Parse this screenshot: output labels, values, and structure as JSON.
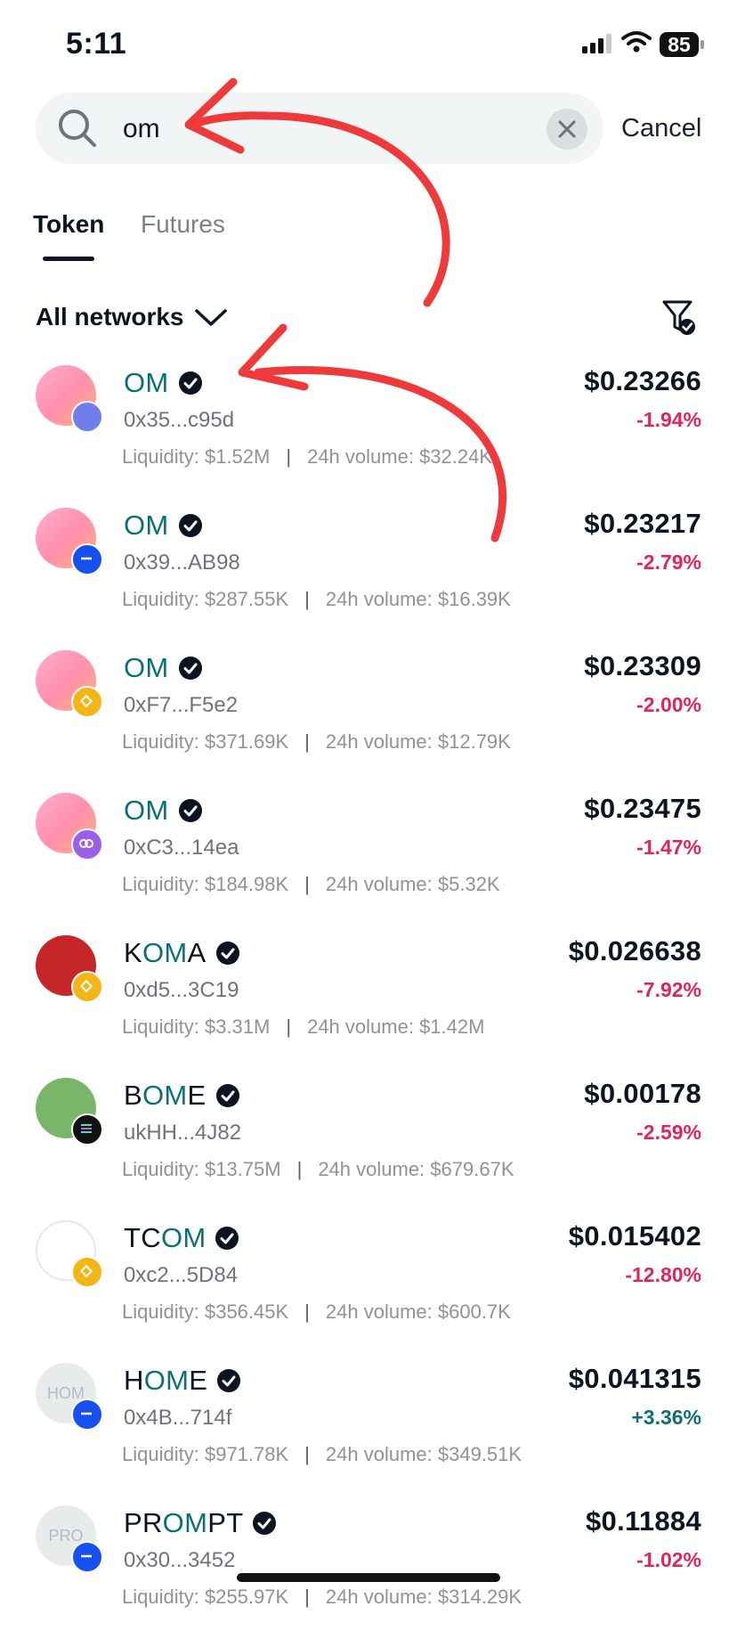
{
  "status_bar": {
    "time": "5:11",
    "battery": "85"
  },
  "search": {
    "value": "om",
    "cancel_label": "Cancel"
  },
  "tabs": [
    {
      "label": "Token",
      "active": true
    },
    {
      "label": "Futures",
      "active": false
    }
  ],
  "network_filter": {
    "label": "All networks"
  },
  "labels": {
    "liquidity": "Liquidity:",
    "volume": "24h volume:"
  },
  "colors": {
    "highlight": "#0d6f7a",
    "negative": "#e0245e",
    "positive": "#0d6f7a",
    "annotation": "#ee3a3a"
  },
  "tokens": [
    {
      "pre": "",
      "hl": "OM",
      "post": "",
      "addr": "0x35...c95d",
      "liquidity": "$1.52M",
      "volume": "$32.24K",
      "price": "$0.23266",
      "change": "-1.94%",
      "dir": "neg",
      "avatar": "om",
      "chain": "ethereum-icon"
    },
    {
      "pre": "",
      "hl": "OM",
      "post": "",
      "addr": "0x39...AB98",
      "liquidity": "$287.55K",
      "volume": "$16.39K",
      "price": "$0.23217",
      "change": "-2.79%",
      "dir": "neg",
      "avatar": "om",
      "chain": "base-icon"
    },
    {
      "pre": "",
      "hl": "OM",
      "post": "",
      "addr": "0xF7...F5e2",
      "liquidity": "$371.69K",
      "volume": "$12.79K",
      "price": "$0.23309",
      "change": "-2.00%",
      "dir": "neg",
      "avatar": "om",
      "chain": "bnb-icon"
    },
    {
      "pre": "",
      "hl": "OM",
      "post": "",
      "addr": "0xC3...14ea",
      "liquidity": "$184.98K",
      "volume": "$5.32K",
      "price": "$0.23475",
      "change": "-1.47%",
      "dir": "neg",
      "avatar": "om",
      "chain": "polygon-icon"
    },
    {
      "pre": "K",
      "hl": "OM",
      "post": "A",
      "addr": "0xd5...3C19",
      "liquidity": "$3.31M",
      "volume": "$1.42M",
      "price": "$0.026638",
      "change": "-7.92%",
      "dir": "neg",
      "avatar": "koma",
      "chain": "bnb-icon"
    },
    {
      "pre": "B",
      "hl": "OM",
      "post": "E",
      "addr": "ukHH...4J82",
      "liquidity": "$13.75M",
      "volume": "$679.67K",
      "price": "$0.00178",
      "change": "-2.59%",
      "dir": "neg",
      "avatar": "bome",
      "chain": "solana-icon"
    },
    {
      "pre": "TC",
      "hl": "OM",
      "post": "",
      "addr": "0xc2...5D84",
      "liquidity": "$356.45K",
      "volume": "$600.7K",
      "price": "$0.015402",
      "change": "-12.80%",
      "dir": "neg",
      "avatar": "tcom",
      "chain": "bnb-icon"
    },
    {
      "pre": "H",
      "hl": "OM",
      "post": "E",
      "addr": "0x4B...714f",
      "liquidity": "$971.78K",
      "volume": "$349.51K",
      "price": "$0.041315",
      "change": "+3.36%",
      "dir": "pos",
      "avatar": "plain",
      "avatar_text": "HOM",
      "chain": "base-icon"
    },
    {
      "pre": "PR",
      "hl": "OM",
      "post": "PT",
      "addr": "0x30...3452",
      "liquidity": "$255.97K",
      "volume": "$314.29K",
      "price": "$0.11884",
      "change": "-1.02%",
      "dir": "neg",
      "avatar": "plain",
      "avatar_text": "PRO",
      "chain": "base-icon"
    }
  ]
}
